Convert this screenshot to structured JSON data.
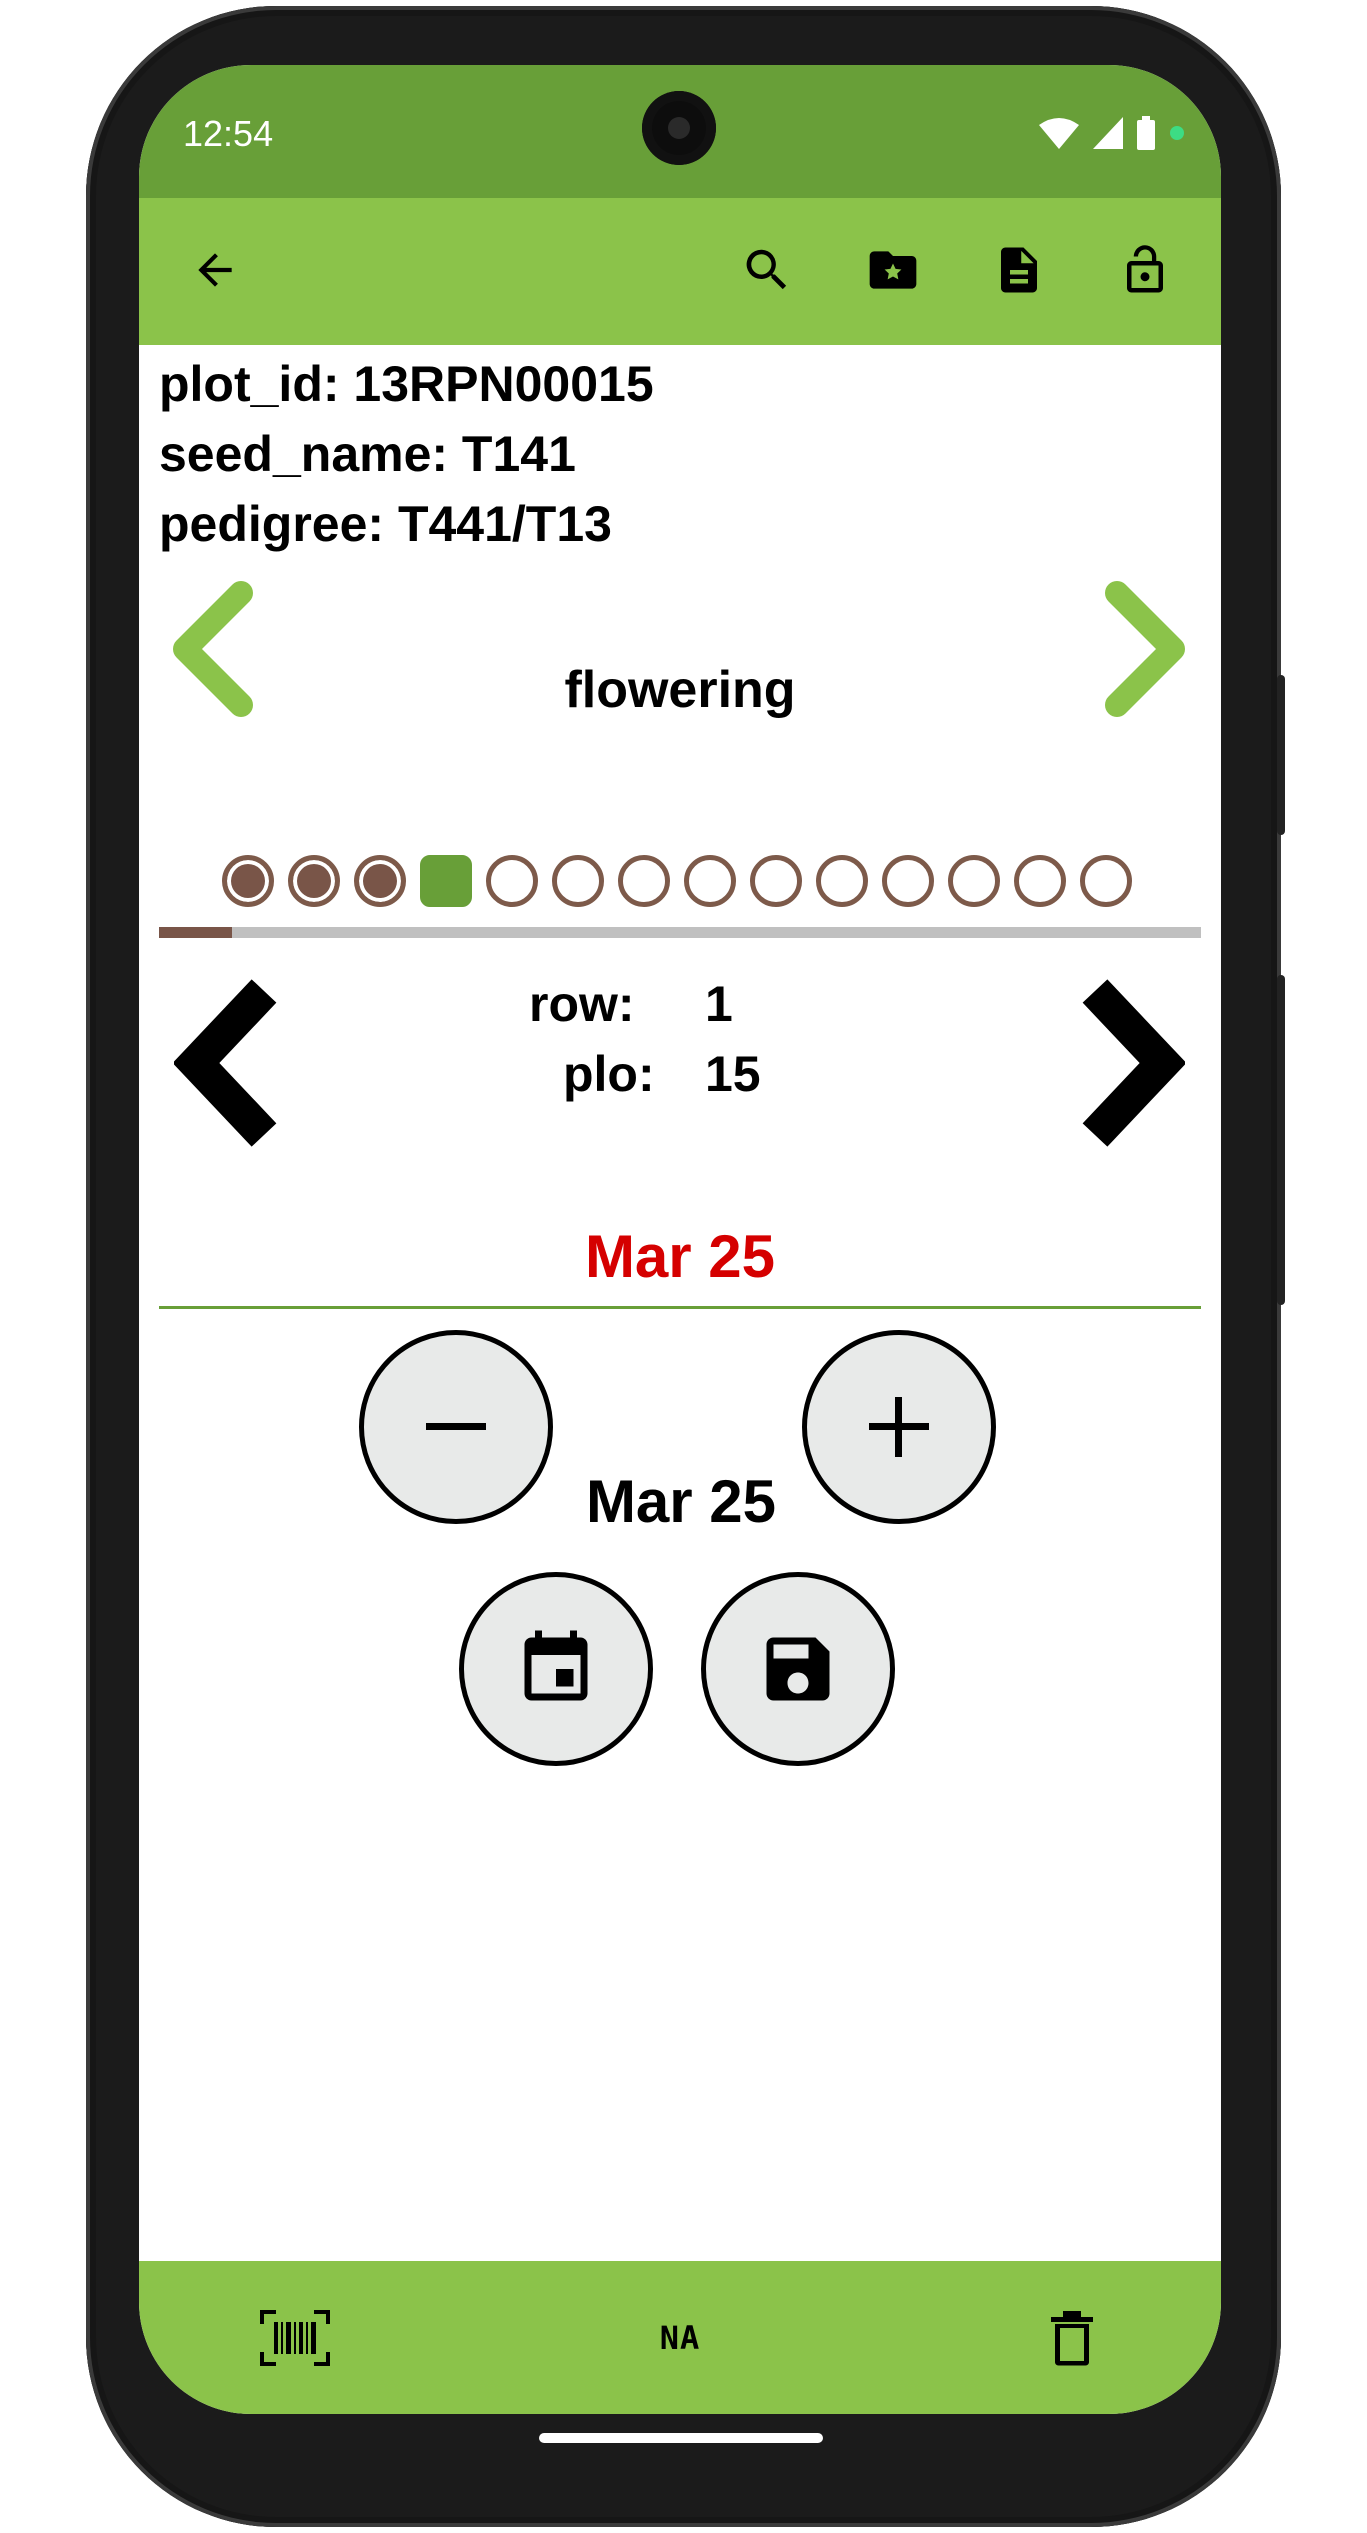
{
  "status_bar": {
    "time": "12:54",
    "icons": [
      "wifi-icon",
      "cellular-signal-icon",
      "battery-icon",
      "notification-dot-icon"
    ],
    "color": "#689f38"
  },
  "toolbar": {
    "color": "#8bc34a",
    "icons": [
      "back-arrow-icon",
      "search-icon",
      "favorite-folder-icon",
      "summary-document-icon",
      "lock-open-icon"
    ]
  },
  "plot_info": {
    "plot_id": "plot_id: 13RPN00015",
    "seed_name": "seed_name: T141",
    "pedigree": "pedigree: T441/T13"
  },
  "trait": {
    "name": "flowering",
    "prev_icon": "chevron-left-icon",
    "next_icon": "chevron-right-icon",
    "accent": "#8bc34a"
  },
  "trait_progress": {
    "total": 14,
    "completed": 3,
    "current_index": 3,
    "fraction": 0.07,
    "done_color": "#795548",
    "current_color": "#689f38"
  },
  "entry": {
    "row_label": "row:",
    "row_value": "1",
    "plot_label": "plo:",
    "plot_value": "15"
  },
  "observation": {
    "value": "Mar 25",
    "value_color": "#d50000"
  },
  "date_picker": {
    "current": "Mar 25",
    "decrement_icon": "minus-icon",
    "increment_icon": "plus-icon",
    "calendar_icon": "calendar-icon",
    "save_icon": "floppy-disk-icon"
  },
  "bottom_bar": {
    "barcode_icon": "barcode-scan-icon",
    "na_label": "NA",
    "delete_icon": "trash-icon"
  }
}
